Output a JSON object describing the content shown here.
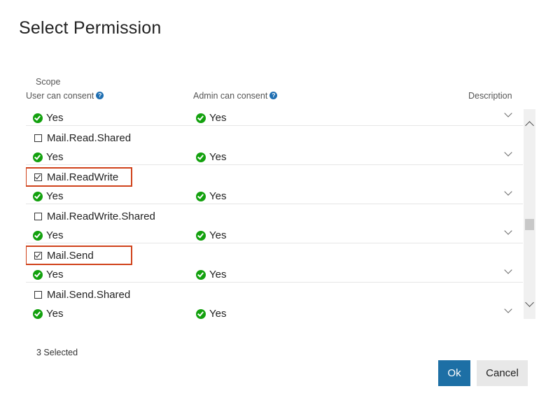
{
  "dialog": {
    "title": "Select Permission"
  },
  "headers": {
    "scope": "Scope",
    "user_consent": "User can consent",
    "admin_consent": "Admin can consent",
    "description": "Description"
  },
  "rows": [
    {
      "name": "",
      "checked": false,
      "highlighted": false,
      "user": "Yes",
      "admin": "Yes"
    },
    {
      "name": "Mail.Read.Shared",
      "checked": false,
      "highlighted": false,
      "user": "Yes",
      "admin": "Yes"
    },
    {
      "name": "Mail.ReadWrite",
      "checked": true,
      "highlighted": true,
      "user": "Yes",
      "admin": "Yes"
    },
    {
      "name": "Mail.ReadWrite.Shared",
      "checked": false,
      "highlighted": false,
      "user": "Yes",
      "admin": "Yes"
    },
    {
      "name": "Mail.Send",
      "checked": true,
      "highlighted": true,
      "user": "Yes",
      "admin": "Yes"
    },
    {
      "name": "Mail.Send.Shared",
      "checked": false,
      "highlighted": false,
      "user": "Yes",
      "admin": "Yes"
    }
  ],
  "footer": {
    "selected_count": "3 Selected",
    "ok_label": "Ok",
    "cancel_label": "Cancel"
  },
  "icons": {
    "help": "help-icon",
    "success": "check-circle-icon",
    "expand": "chevron-down-icon"
  },
  "colors": {
    "accent": "#1d6fa5",
    "success": "#13a10e",
    "highlight": "#d0421b"
  }
}
